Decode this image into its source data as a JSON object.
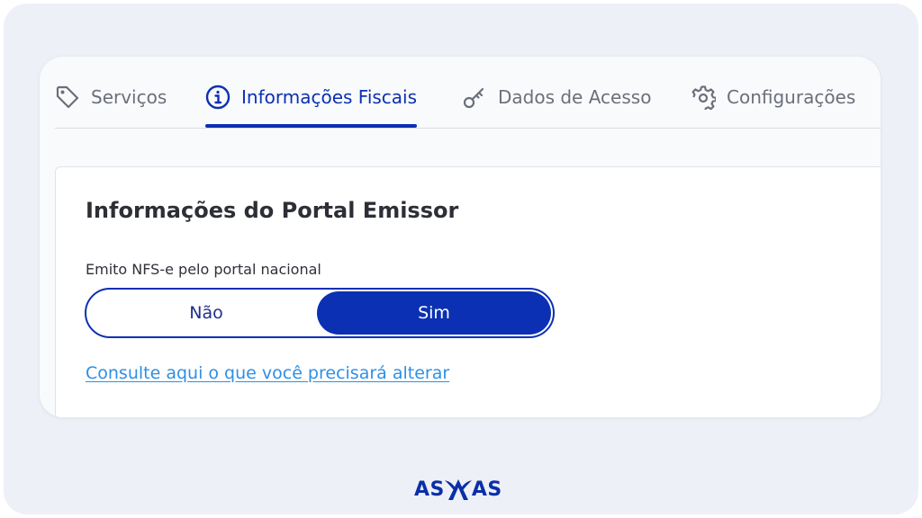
{
  "tabs": [
    {
      "label": "Serviços",
      "icon": "tag-icon",
      "active": false
    },
    {
      "label": "Informações Fiscais",
      "icon": "info-icon",
      "active": true
    },
    {
      "label": "Dados de Acesso",
      "icon": "key-icon",
      "active": false
    },
    {
      "label": "Configurações",
      "icon": "gear-icon",
      "active": false
    }
  ],
  "panel": {
    "title": "Informações do Portal Emissor",
    "field_label": "Emito NFS-e pelo portal nacional",
    "toggle": {
      "no_label": "Não",
      "yes_label": "Sim",
      "selected": "Sim"
    },
    "link_text": "Consulte aqui o que você precisará alterar"
  },
  "logo": {
    "text_left": "AS",
    "text_right": "AS"
  },
  "colors": {
    "accent": "#0b30b3",
    "link": "#2e8fe6",
    "tab_inactive": "#6b6f7b",
    "background": "#eef0f8"
  }
}
